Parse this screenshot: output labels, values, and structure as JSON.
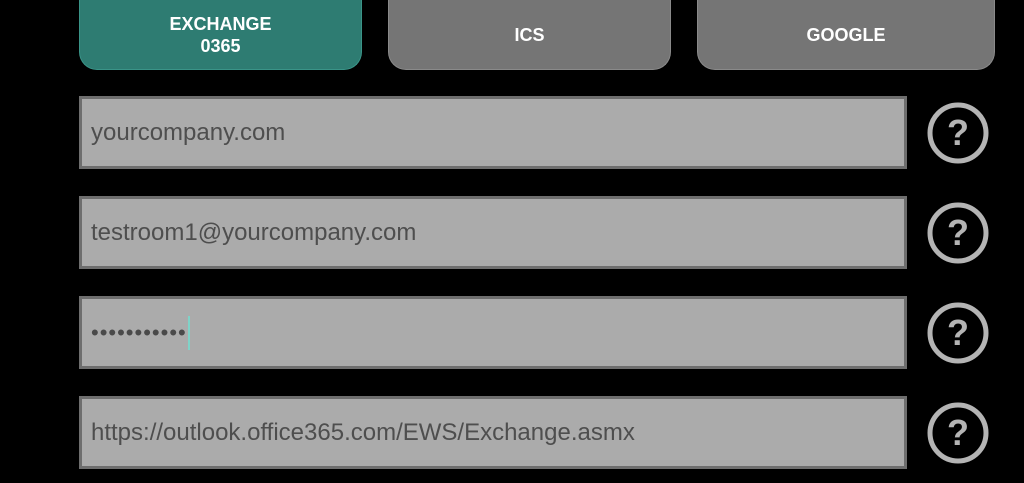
{
  "tabs": [
    {
      "label": "EXCHANGE\n0365",
      "selected": true,
      "color": "#2e7c72"
    },
    {
      "label": "ICS",
      "selected": false,
      "color": "#757575"
    },
    {
      "label": "GOOGLE",
      "selected": false,
      "color": "#757575"
    }
  ],
  "fields": {
    "domain": {
      "value": "yourcompany.com"
    },
    "email": {
      "value": "testroom1@yourcompany.com"
    },
    "password": {
      "value": "•••••••••••"
    },
    "url": {
      "value": "https://outlook.office365.com/EWS/Exchange.asmx"
    }
  },
  "help_icon": {
    "name": "question-circle-icon",
    "color": "#b4b4b4"
  },
  "colors": {
    "background": "#000000",
    "field_bg": "#ababab",
    "field_border": "#6e6e6e",
    "field_text": "#4e4e4e",
    "caret": "#7fd3c8"
  }
}
